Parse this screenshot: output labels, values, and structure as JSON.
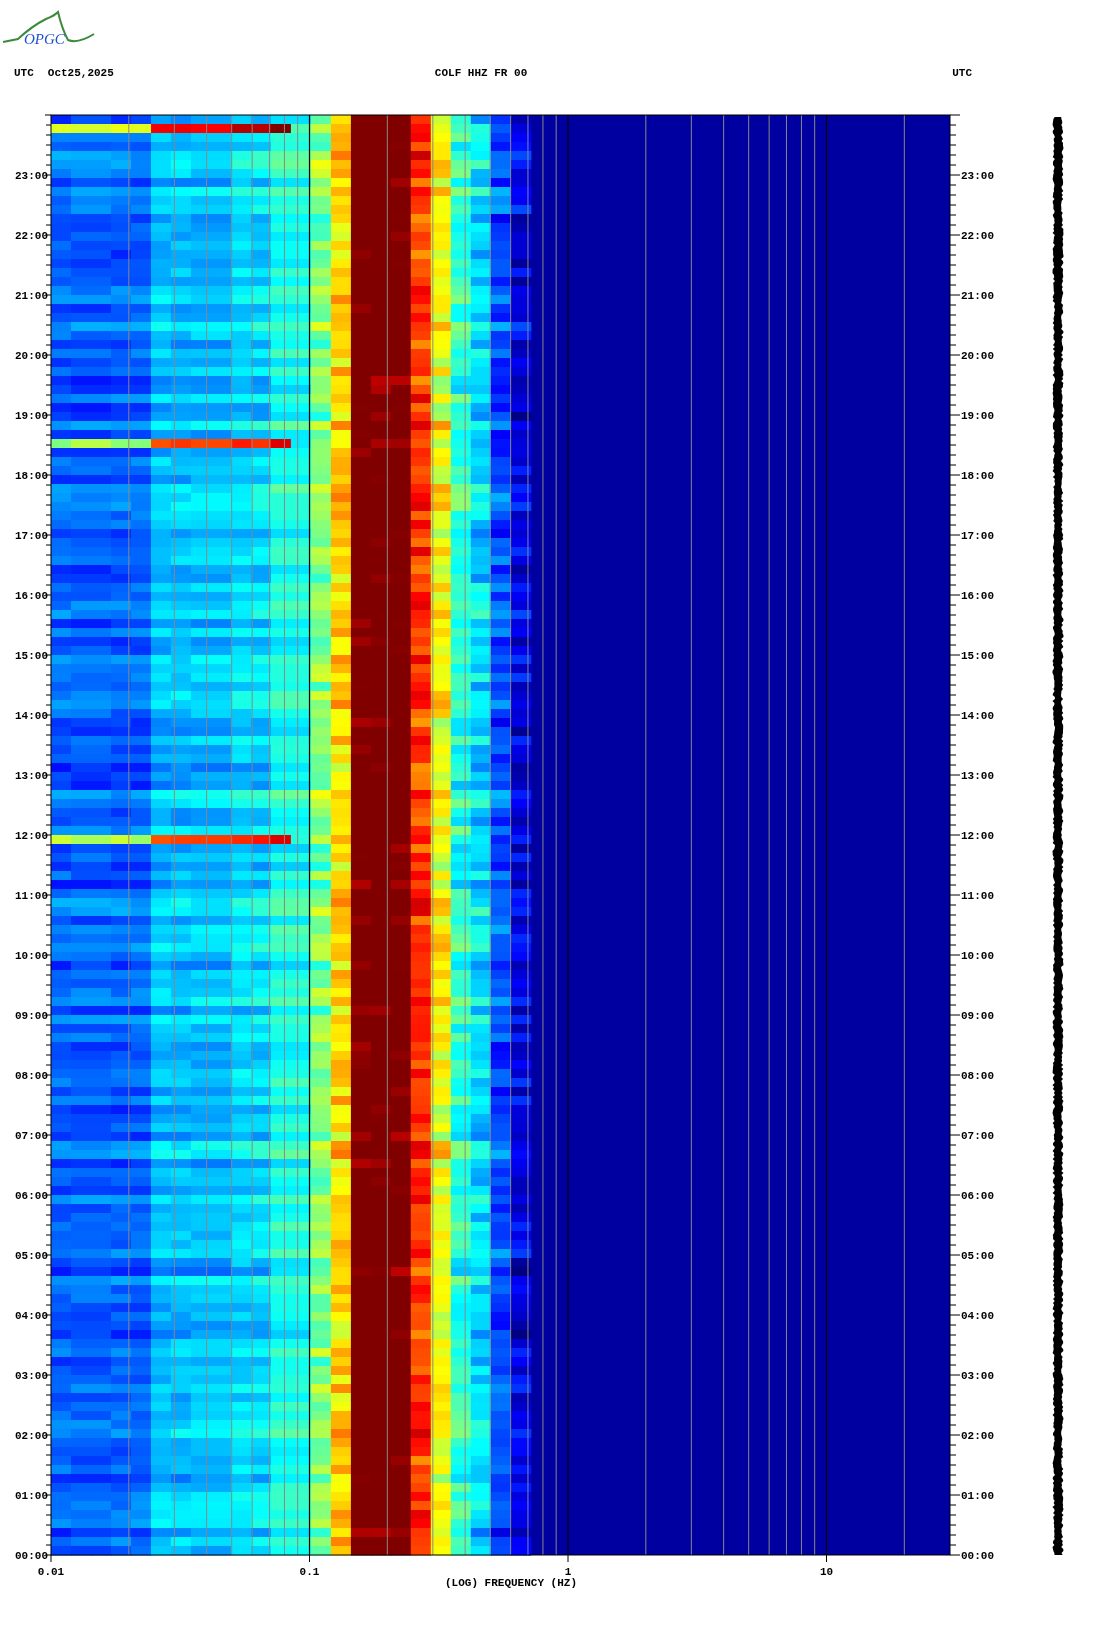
{
  "logo": {
    "text": "OPGC"
  },
  "header": {
    "left_timezone": "UTC",
    "date": "Oct25,2025",
    "station": "COLF HHZ FR 00",
    "right_timezone": "UTC"
  },
  "time_axis": {
    "left_labels": [
      "23:00",
      "22:00",
      "21:00",
      "20:00",
      "19:00",
      "18:00",
      "17:00",
      "16:00",
      "15:00",
      "14:00",
      "13:00",
      "12:00",
      "11:00",
      "10:00",
      "09:00",
      "08:00",
      "07:00",
      "06:00",
      "05:00",
      "04:00",
      "03:00",
      "02:00",
      "01:00",
      "00:00"
    ],
    "right_labels": [
      "23:00",
      "22:00",
      "21:00",
      "20:00",
      "19:00",
      "18:00",
      "17:00",
      "16:00",
      "15:00",
      "14:00",
      "13:00",
      "12:00",
      "11:00",
      "10:00",
      "09:00",
      "08:00",
      "07:00",
      "06:00",
      "05:00",
      "04:00",
      "03:00",
      "02:00",
      "01:00",
      "00:00"
    ]
  },
  "frequency_axis": {
    "ticks": [
      "0.01",
      "0.1",
      "1",
      "10"
    ],
    "label": "(LOG) FREQUENCY (HZ)"
  }
}
